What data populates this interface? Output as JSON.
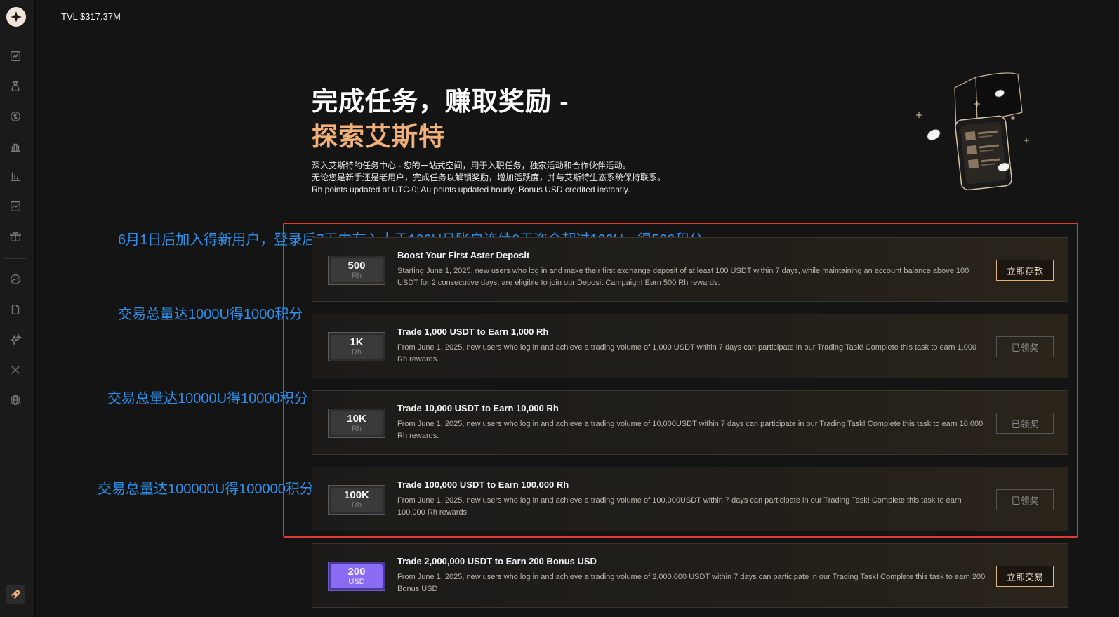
{
  "header": {
    "tvl": "TVL $317.37M"
  },
  "hero": {
    "title_line1": "完成任务，赚取奖励 -",
    "title_line2": "探索艾斯特",
    "desc_line1": "深入艾斯特的任务中心 - 您的一站式空间，用于入职任务，独家活动和合作伙伴活动。",
    "desc_line2": "无论您是新手还是老用户，完成任务以解锁奖励，增加活跃度，并与艾斯特生态系统保持联系。",
    "desc_line3": "Rh points updated at UTC-0; Au points updated hourly; Bonus USD credited instantly."
  },
  "annotations": [
    "6月1日后加入得新用户，登录后7天内存入大于100U且账户连续2天资金超过100U，得500积分",
    "交易总量达1000U得1000积分",
    "交易总量达10000U得10000积分",
    "交易总量达100000U得100000积分"
  ],
  "tasks": [
    {
      "badge_value": "500",
      "badge_unit": "Rh",
      "title": "Boost Your First Aster Deposit",
      "desc": "Starting June 1, 2025, new users who log in and make their first exchange deposit of at least 100 USDT within 7 days, while maintaining an account balance above 100 USDT for 2 consecutive days, are eligible to join our Deposit Campaign! Earn 500 Rh rewards.",
      "button": "立即存款"
    },
    {
      "badge_value": "1K",
      "badge_unit": "Rh",
      "title": "Trade 1,000 USDT to Earn 1,000 Rh",
      "desc": "From June 1, 2025, new users who log in and achieve a trading volume of 1,000 USDT within 7 days can participate in our Trading Task! Complete this task to earn 1,000 Rh rewards.",
      "button": "已领奖"
    },
    {
      "badge_value": "10K",
      "badge_unit": "Rh",
      "title": "Trade 10,000 USDT to Earn 10,000 Rh",
      "desc": "From June 1, 2025, new users who log in and achieve a trading volume of 10,000USDT within 7 days can participate in our Trading Task! Complete this task to earn 10,000 Rh rewards.",
      "button": "已领奖"
    },
    {
      "badge_value": "100K",
      "badge_unit": "Rh",
      "title": "Trade 100,000 USDT to Earn 100,000 Rh",
      "desc": "From June 1, 2025, new users who log in and achieve a trading volume of 100,000USDT within 7 days can participate in our Trading Task! Complete this task to earn 100,000 Rh rewards",
      "button": "已领奖"
    },
    {
      "badge_value": "200",
      "badge_unit": "USD",
      "title": "Trade 2,000,000 USDT to Earn 200 Bonus USD",
      "desc": "From June 1, 2025, new users who log in and achieve a trading volume of 2,000,000 USDT within 7 days can participate in our Trading Task! Complete this task to earn 200 Bonus USD",
      "button": "立即交易"
    }
  ],
  "colors": {
    "accent": "#f0b07a",
    "annotation": "#2f8fe8",
    "annotation_box": "#e23a30",
    "purple_badge": "#8a6cf4"
  },
  "icons": [
    "logo-icon",
    "chart-icon",
    "bag-icon",
    "dollar-icon",
    "bar-chart-icon",
    "column-chart-icon",
    "trend-icon",
    "gift-icon",
    "globe-chat-icon",
    "document-icon",
    "sparkle-icon",
    "x-icon",
    "world-icon",
    "rocket-icon"
  ]
}
